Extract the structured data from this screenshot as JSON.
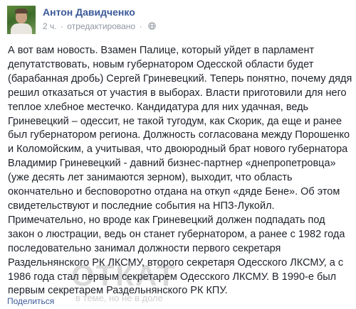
{
  "post": {
    "author": "Антон Давидченко",
    "time": "2 ч.",
    "separator": "·",
    "edited": "отредактировано",
    "separator2": "·",
    "privacy_icon": "globe-icon",
    "text": "А вот вам новость. Взамен Палице, который уйдет в парламент депутатствовать, новым губернатором Одесской области будет (барабанная дробь) Сергей Гриневецкий. Теперь понятно, почему дядя решил отказаться от участия в выборах. Власти приготовили для него теплое хлебное местечко. Кандидатура для них удачная, ведь Гриневецкий – одессит, не такой тугодум, как Скорик, да еще и ранее был губернатором региона. Должность согласована между Порошенко и Коломойским, а учитывая, что двоюродный брат нового губернатора Владимир Гриневецкий - давний бизнес-партнер «днепропетровца» (уже десять лет занимаются зерном), выходит, что область окончательно и бесповоротно отдана на откуп «дяде Бене». Об этом свидетельствуют и последние события на НПЗ-Лукойл. Примечательно, но вроде как Гриневецкий должен подпадать под закон о люстрации, ведь он станет губернатором, а ранее с 1982 года последовательно занимал должности первого секретаря Раздельнянского РК ЛКСМУ, второго секретаря Одесского ЛКСМУ, а с 1986 года стал первым секретарем Одесского ЛКСМУ. В 1990-е был первым секретарем Раздельнянского РК КПУ.",
    "share_label": "Поделиться"
  },
  "watermark": {
    "title": "ОТКАТ",
    "subtitle": "в теме, но не в доле"
  },
  "colors": {
    "link": "#3b5998",
    "meta": "#9197a3",
    "text": "#1d2129"
  }
}
